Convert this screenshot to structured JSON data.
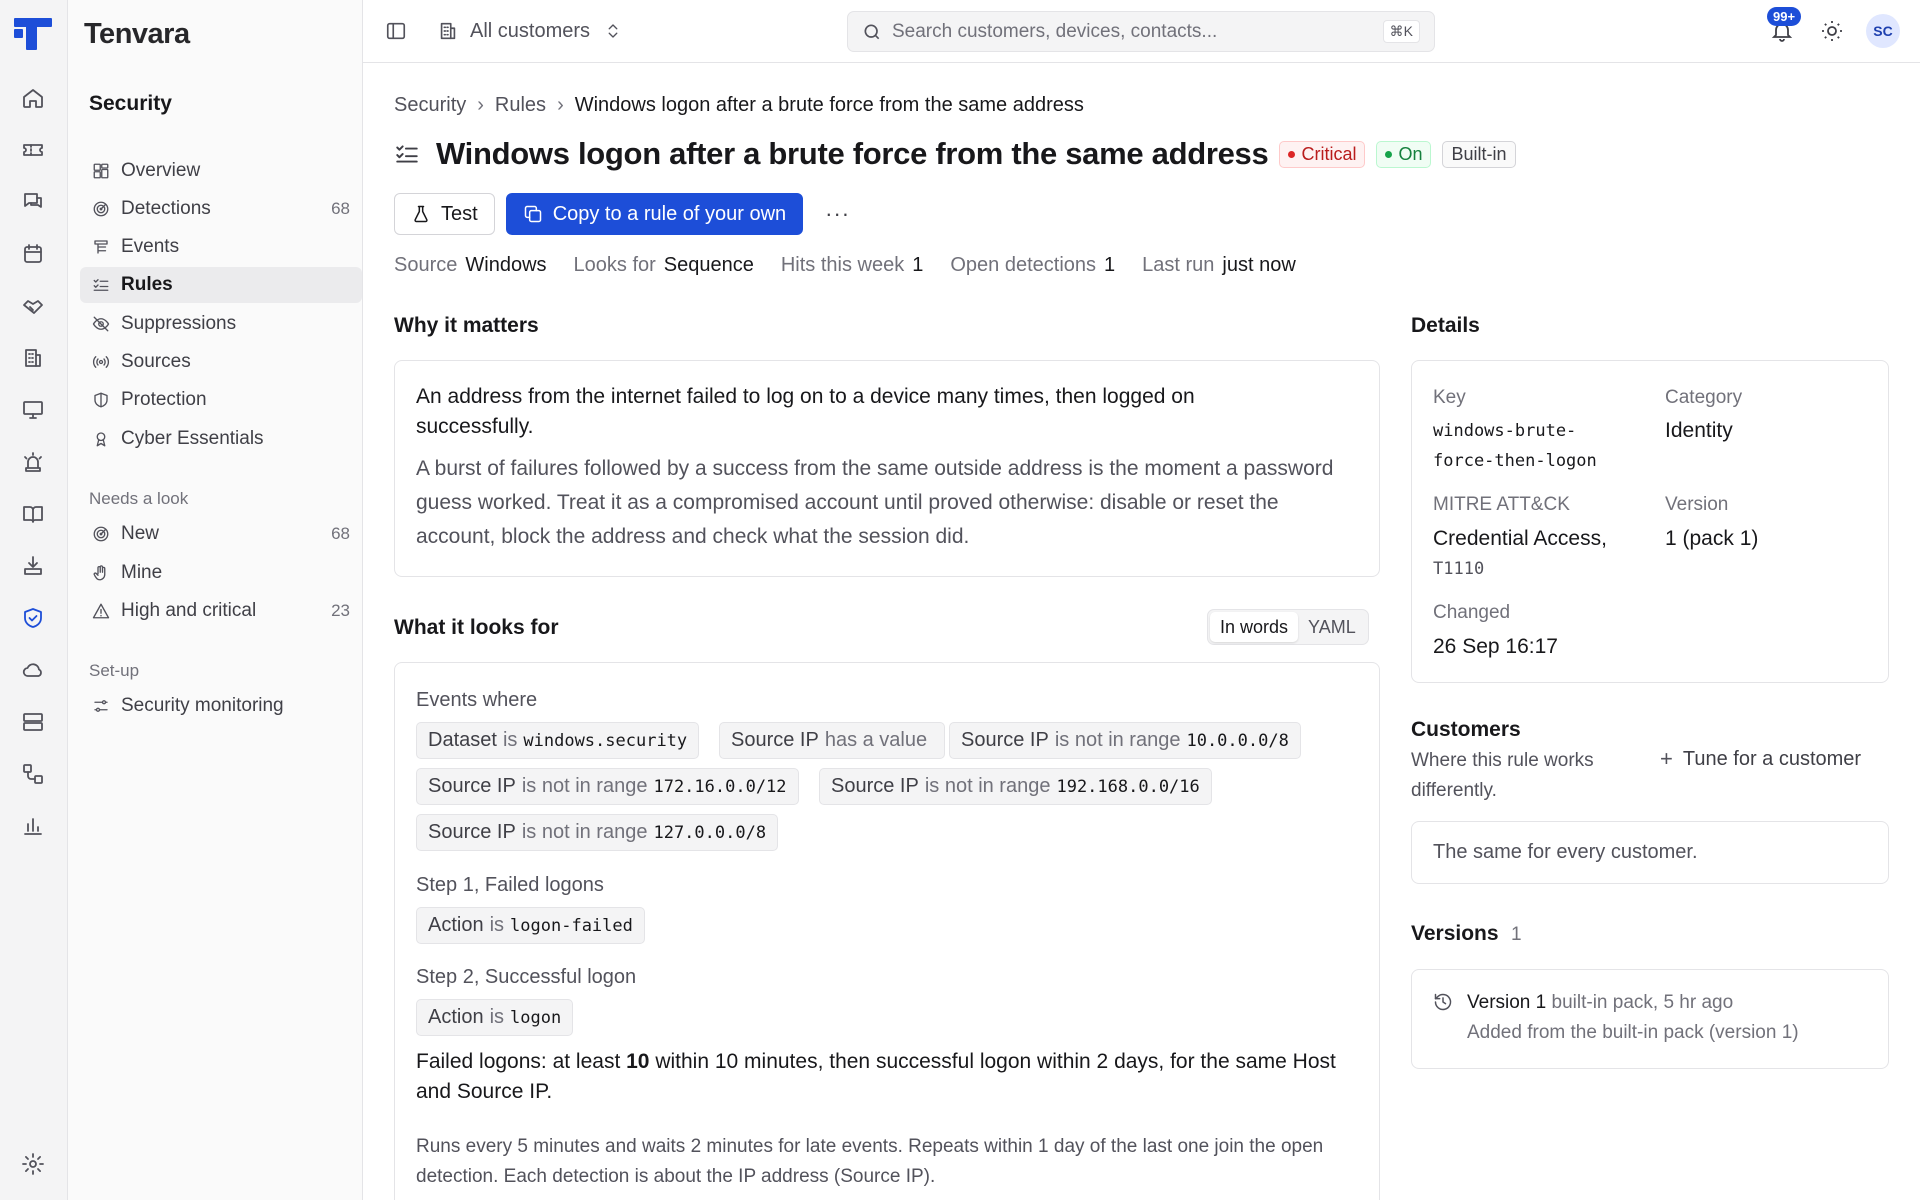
{
  "app": {
    "brand": "Tenvara"
  },
  "topbar": {
    "customer_scope": "All customers",
    "search_placeholder": "Search customers, devices, contacts...",
    "search_shortcut": "⌘K",
    "notifications_badge": "99+",
    "avatar_initials": "SC"
  },
  "sidebar": {
    "section": "Security",
    "items": [
      {
        "label": "Overview",
        "icon": "layout-grid-icon",
        "count": ""
      },
      {
        "label": "Detections",
        "icon": "radar-icon",
        "count": "68"
      },
      {
        "label": "Events",
        "icon": "logs-icon",
        "count": ""
      },
      {
        "label": "Rules",
        "icon": "list-checks-icon",
        "count": ""
      },
      {
        "label": "Suppressions",
        "icon": "eye-off-icon",
        "count": ""
      },
      {
        "label": "Sources",
        "icon": "broadcast-icon",
        "count": ""
      },
      {
        "label": "Protection",
        "icon": "shield-half-icon",
        "count": ""
      },
      {
        "label": "Cyber Essentials",
        "icon": "award-icon",
        "count": ""
      }
    ],
    "needs_look_label": "Needs a look",
    "needs_look": [
      {
        "label": "New",
        "icon": "radar-icon",
        "count": "68"
      },
      {
        "label": "Mine",
        "icon": "hand-icon",
        "count": ""
      },
      {
        "label": "High and critical",
        "icon": "warning-icon",
        "count": "23"
      }
    ],
    "setup_label": "Set-up",
    "setup": [
      {
        "label": "Security monitoring",
        "icon": "sliders-icon",
        "count": ""
      }
    ]
  },
  "breadcrumb": [
    "Security",
    "Rules",
    "Windows logon after a brute force from the same address"
  ],
  "rule": {
    "title": "Windows logon after a brute force from the same address",
    "severity": "Critical",
    "state": "On",
    "origin": "Built-in",
    "actions": {
      "test": "Test",
      "copy": "Copy to a rule of your own",
      "more": "···"
    },
    "meta": [
      {
        "key": "Source",
        "value": "Windows"
      },
      {
        "key": "Looks for",
        "value": "Sequence"
      },
      {
        "key": "Hits this week",
        "value": "1"
      },
      {
        "key": "Open detections",
        "value": "1"
      },
      {
        "key": "Last run",
        "value": "just now"
      }
    ]
  },
  "why": {
    "heading": "Why it matters",
    "lead": "An address from the internet failed to log on to a device many times, then logged on successfully.",
    "body": "A burst of failures followed by a success from the same outside address is the moment a password guess worked. Treat it as a compromised account until proved otherwise: disable or reset the account, block the address and check what the session did."
  },
  "looks_for": {
    "heading": "What it looks for",
    "toggle": [
      "In words",
      "YAML"
    ],
    "events_label": "Events where",
    "conditions": [
      {
        "field": "Dataset",
        "op": "is",
        "value": "windows.security"
      },
      {
        "field": "Source IP",
        "op": "has a value",
        "value": ""
      },
      {
        "field": "Source IP",
        "op": "is not in range",
        "value": "10.0.0.0/8"
      },
      {
        "field": "Source IP",
        "op": "is not in range",
        "value": "172.16.0.0/12"
      },
      {
        "field": "Source IP",
        "op": "is not in range",
        "value": "192.168.0.0/16"
      },
      {
        "field": "Source IP",
        "op": "is not in range",
        "value": "127.0.0.0/8"
      }
    ],
    "step1_label": "Step 1, Failed logons",
    "step1": {
      "field": "Action",
      "op": "is",
      "value": "logon-failed"
    },
    "step2_label": "Step 2, Successful logon",
    "step2": {
      "field": "Action",
      "op": "is",
      "value": "logon"
    },
    "summary_a": "Failed logons: at least ",
    "summary_n": "10",
    "summary_b": " within 10 minutes, then successful logon within 2 days, for the same Host and Source IP.",
    "runs": "Runs every 5 minutes and waits 2 minutes for late events. Repeats within 1 day of the last one join the open detection. Each detection is about the IP address (Source IP)."
  },
  "details": {
    "heading": "Details",
    "key_label": "Key",
    "key_value_1": "windows-brute-",
    "key_value_2": "force-then-logon",
    "category_label": "Category",
    "category_value": "Identity",
    "mitre_label": "MITRE ATT&CK",
    "mitre_tactic": "Credential Access,",
    "mitre_id": "T1110",
    "version_label": "Version",
    "version_value": "1 (pack 1)",
    "changed_label": "Changed",
    "changed_value": "26 Sep 16:17"
  },
  "customers": {
    "heading": "Customers",
    "subtitle": "Where this rule works differently.",
    "tune": "Tune for a customer",
    "same": "The same for every customer."
  },
  "versions": {
    "heading": "Versions",
    "count": "1",
    "item_name": "Version 1",
    "item_meta": " built-in pack, 5 hr ago",
    "item_desc": "Added from the built-in pack (version 1)"
  },
  "colors": {
    "accent": "#1d4ed8",
    "critical": "#dc2626",
    "on": "#16a34a"
  }
}
